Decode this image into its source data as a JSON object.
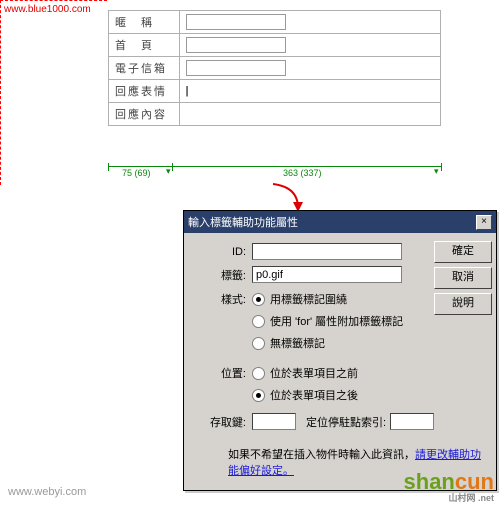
{
  "watermarks": {
    "top": "www.blue1000.com",
    "bottom": "www.webyi.com"
  },
  "table": {
    "rows": [
      {
        "label": "暱　稱"
      },
      {
        "label": "首　頁"
      },
      {
        "label": "電子信箱"
      },
      {
        "label": "回應表情"
      },
      {
        "label": "回應內容"
      }
    ]
  },
  "ruler": {
    "left": "75 (69)",
    "right": "363 (337)"
  },
  "dialog": {
    "title": "輸入標籤輔助功能屬性",
    "buttons": {
      "ok": "確定",
      "cancel": "取消",
      "help": "說明"
    },
    "fields": {
      "id_label": "ID:",
      "id_value": "",
      "tag_label": "標籤:",
      "tag_value": "p0.gif",
      "style_label": "樣式:",
      "style_opts": [
        "用標籤標記圍繞",
        "使用 'for' 屬性附加標籤標記",
        "無標籤標記"
      ],
      "pos_label": "位置:",
      "pos_opts": [
        "位於表單項目之前",
        "位於表單項目之後"
      ],
      "access_label": "存取鍵:",
      "access_value": "",
      "tab_label": "定位停駐點索引:",
      "tab_value": ""
    },
    "note_a": "如果不希望在插入物件時輸入此資訊，",
    "note_b": "請更改輔助功能偏好設定。"
  },
  "brand": {
    "a": "shan",
    "b": "cun",
    "c": "山村网 .net"
  }
}
